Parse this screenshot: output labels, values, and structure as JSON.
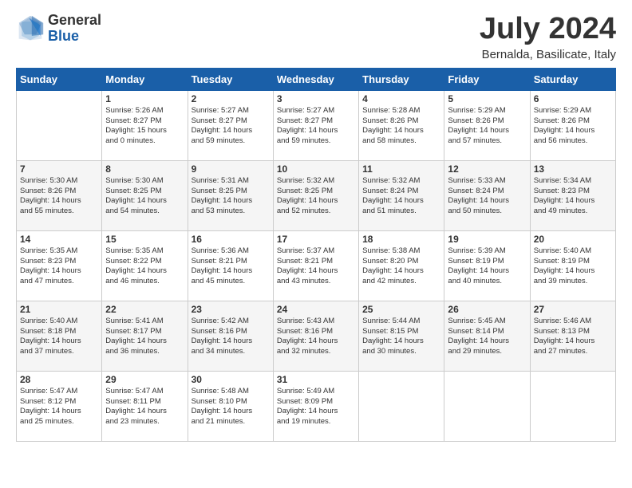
{
  "logo": {
    "general": "General",
    "blue": "Blue"
  },
  "title": "July 2024",
  "subtitle": "Bernalda, Basilicate, Italy",
  "days_header": [
    "Sunday",
    "Monday",
    "Tuesday",
    "Wednesday",
    "Thursday",
    "Friday",
    "Saturday"
  ],
  "weeks": [
    [
      {
        "num": "",
        "info": ""
      },
      {
        "num": "1",
        "info": "Sunrise: 5:26 AM\nSunset: 8:27 PM\nDaylight: 15 hours\nand 0 minutes."
      },
      {
        "num": "2",
        "info": "Sunrise: 5:27 AM\nSunset: 8:27 PM\nDaylight: 14 hours\nand 59 minutes."
      },
      {
        "num": "3",
        "info": "Sunrise: 5:27 AM\nSunset: 8:27 PM\nDaylight: 14 hours\nand 59 minutes."
      },
      {
        "num": "4",
        "info": "Sunrise: 5:28 AM\nSunset: 8:26 PM\nDaylight: 14 hours\nand 58 minutes."
      },
      {
        "num": "5",
        "info": "Sunrise: 5:29 AM\nSunset: 8:26 PM\nDaylight: 14 hours\nand 57 minutes."
      },
      {
        "num": "6",
        "info": "Sunrise: 5:29 AM\nSunset: 8:26 PM\nDaylight: 14 hours\nand 56 minutes."
      }
    ],
    [
      {
        "num": "7",
        "info": "Sunrise: 5:30 AM\nSunset: 8:26 PM\nDaylight: 14 hours\nand 55 minutes."
      },
      {
        "num": "8",
        "info": "Sunrise: 5:30 AM\nSunset: 8:25 PM\nDaylight: 14 hours\nand 54 minutes."
      },
      {
        "num": "9",
        "info": "Sunrise: 5:31 AM\nSunset: 8:25 PM\nDaylight: 14 hours\nand 53 minutes."
      },
      {
        "num": "10",
        "info": "Sunrise: 5:32 AM\nSunset: 8:25 PM\nDaylight: 14 hours\nand 52 minutes."
      },
      {
        "num": "11",
        "info": "Sunrise: 5:32 AM\nSunset: 8:24 PM\nDaylight: 14 hours\nand 51 minutes."
      },
      {
        "num": "12",
        "info": "Sunrise: 5:33 AM\nSunset: 8:24 PM\nDaylight: 14 hours\nand 50 minutes."
      },
      {
        "num": "13",
        "info": "Sunrise: 5:34 AM\nSunset: 8:23 PM\nDaylight: 14 hours\nand 49 minutes."
      }
    ],
    [
      {
        "num": "14",
        "info": "Sunrise: 5:35 AM\nSunset: 8:23 PM\nDaylight: 14 hours\nand 47 minutes."
      },
      {
        "num": "15",
        "info": "Sunrise: 5:35 AM\nSunset: 8:22 PM\nDaylight: 14 hours\nand 46 minutes."
      },
      {
        "num": "16",
        "info": "Sunrise: 5:36 AM\nSunset: 8:21 PM\nDaylight: 14 hours\nand 45 minutes."
      },
      {
        "num": "17",
        "info": "Sunrise: 5:37 AM\nSunset: 8:21 PM\nDaylight: 14 hours\nand 43 minutes."
      },
      {
        "num": "18",
        "info": "Sunrise: 5:38 AM\nSunset: 8:20 PM\nDaylight: 14 hours\nand 42 minutes."
      },
      {
        "num": "19",
        "info": "Sunrise: 5:39 AM\nSunset: 8:19 PM\nDaylight: 14 hours\nand 40 minutes."
      },
      {
        "num": "20",
        "info": "Sunrise: 5:40 AM\nSunset: 8:19 PM\nDaylight: 14 hours\nand 39 minutes."
      }
    ],
    [
      {
        "num": "21",
        "info": "Sunrise: 5:40 AM\nSunset: 8:18 PM\nDaylight: 14 hours\nand 37 minutes."
      },
      {
        "num": "22",
        "info": "Sunrise: 5:41 AM\nSunset: 8:17 PM\nDaylight: 14 hours\nand 36 minutes."
      },
      {
        "num": "23",
        "info": "Sunrise: 5:42 AM\nSunset: 8:16 PM\nDaylight: 14 hours\nand 34 minutes."
      },
      {
        "num": "24",
        "info": "Sunrise: 5:43 AM\nSunset: 8:16 PM\nDaylight: 14 hours\nand 32 minutes."
      },
      {
        "num": "25",
        "info": "Sunrise: 5:44 AM\nSunset: 8:15 PM\nDaylight: 14 hours\nand 30 minutes."
      },
      {
        "num": "26",
        "info": "Sunrise: 5:45 AM\nSunset: 8:14 PM\nDaylight: 14 hours\nand 29 minutes."
      },
      {
        "num": "27",
        "info": "Sunrise: 5:46 AM\nSunset: 8:13 PM\nDaylight: 14 hours\nand 27 minutes."
      }
    ],
    [
      {
        "num": "28",
        "info": "Sunrise: 5:47 AM\nSunset: 8:12 PM\nDaylight: 14 hours\nand 25 minutes."
      },
      {
        "num": "29",
        "info": "Sunrise: 5:47 AM\nSunset: 8:11 PM\nDaylight: 14 hours\nand 23 minutes."
      },
      {
        "num": "30",
        "info": "Sunrise: 5:48 AM\nSunset: 8:10 PM\nDaylight: 14 hours\nand 21 minutes."
      },
      {
        "num": "31",
        "info": "Sunrise: 5:49 AM\nSunset: 8:09 PM\nDaylight: 14 hours\nand 19 minutes."
      },
      {
        "num": "",
        "info": ""
      },
      {
        "num": "",
        "info": ""
      },
      {
        "num": "",
        "info": ""
      }
    ]
  ]
}
